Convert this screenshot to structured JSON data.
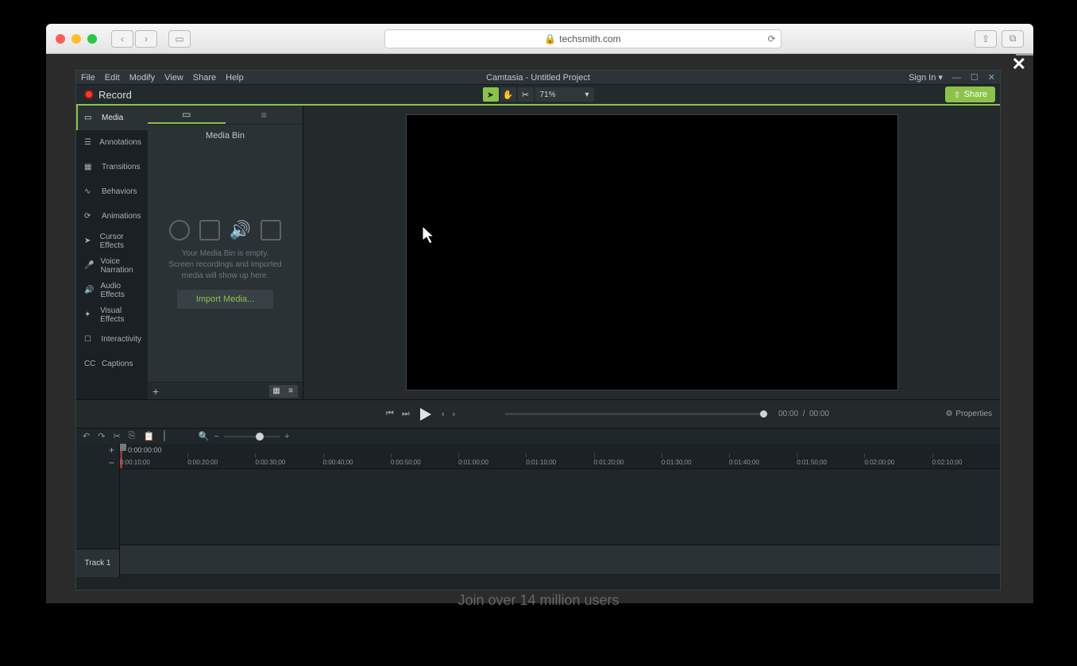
{
  "browser": {
    "url_host": "techsmith.com",
    "page_caption": "Join over 14 million users"
  },
  "app": {
    "title": "Camtasia - Untitled Project",
    "menus": [
      "File",
      "Edit",
      "Modify",
      "View",
      "Share",
      "Help"
    ],
    "sign_in": "Sign In",
    "record_label": "Record",
    "zoom": "71%",
    "share_label": "Share"
  },
  "sidebar": {
    "items": [
      {
        "label": "Media"
      },
      {
        "label": "Annotations"
      },
      {
        "label": "Transitions"
      },
      {
        "label": "Behaviors"
      },
      {
        "label": "Animations"
      },
      {
        "label": "Cursor Effects"
      },
      {
        "label": "Voice Narration"
      },
      {
        "label": "Audio Effects"
      },
      {
        "label": "Visual Effects"
      },
      {
        "label": "Interactivity"
      },
      {
        "label": "Captions"
      }
    ]
  },
  "bin": {
    "title": "Media Bin",
    "empty_msg": "Your Media Bin is empty.\nScreen recordings and imported media will show up here.",
    "import_label": "Import Media..."
  },
  "playback": {
    "current": "00:00",
    "total": "00:00",
    "properties": "Properties"
  },
  "timeline": {
    "start": "0:00:00:00",
    "track_label": "Track 1",
    "ticks": [
      "0:00:10;00",
      "0:00:20;00",
      "0:00:30;00",
      "0:00:40;00",
      "0:00:50;00",
      "0:01:00;00",
      "0:01:10;00",
      "0:01:20;00",
      "0:01:30;00",
      "0:01:40;00",
      "0:01:50;00",
      "0:02:00;00",
      "0:02:10;00"
    ]
  }
}
